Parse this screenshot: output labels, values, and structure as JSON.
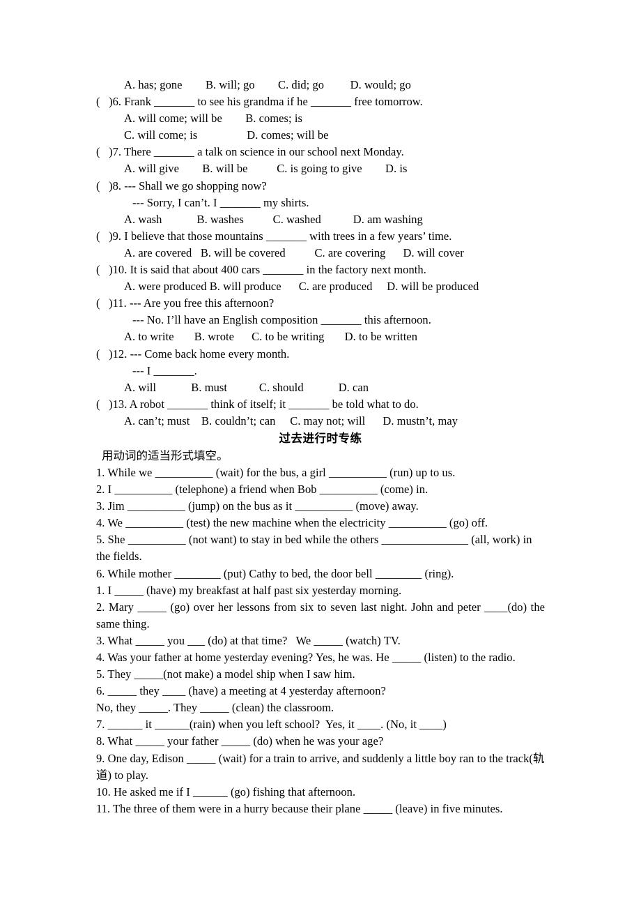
{
  "document": {
    "sections": [
      {
        "id": "multiple-choice-continued",
        "lines": [
          {
            "kind": "options",
            "text": "A. has; gone        B. will; go        C. did; go         D. would; go"
          },
          {
            "kind": "stem",
            "text": "(   )6. Frank _______ to see his grandma if he _______ free tomorrow."
          },
          {
            "kind": "options",
            "text": "A. will come; will be        B. comes; is"
          },
          {
            "kind": "options",
            "text": "C. will come; is                 D. comes; will be"
          },
          {
            "kind": "stem",
            "text": "(   )7. There _______ a talk on science in our school next Monday."
          },
          {
            "kind": "options",
            "text": "A. will give        B. will be          C. is going to give        D. is"
          },
          {
            "kind": "stem",
            "text": "(   )8. --- Shall we go shopping now?"
          },
          {
            "kind": "dash",
            "text": "--- Sorry, I can’t. I _______ my shirts."
          },
          {
            "kind": "options",
            "text": "A. wash            B. washes          C. washed           D. am washing"
          },
          {
            "kind": "stem",
            "text": "(   )9. I believe that those mountains _______ with trees in a few years’ time."
          },
          {
            "kind": "options",
            "text": "A. are covered   B. will be covered          C. are covering      D. will cover"
          },
          {
            "kind": "stem",
            "text": "(   )10. It is said that about 400 cars _______ in the factory next month."
          },
          {
            "kind": "options",
            "text": "A. were produced B. will produce      C. are produced     D. will be produced"
          },
          {
            "kind": "stem",
            "text": "(   )11. --- Are you free this afternoon?"
          },
          {
            "kind": "dash",
            "text": "--- No. I’ll have an English composition _______ this afternoon."
          },
          {
            "kind": "options",
            "text": "A. to write       B. wrote      C. to be writing       D. to be written"
          },
          {
            "kind": "stem",
            "text": "(   )12. --- Come back home every month."
          },
          {
            "kind": "dash",
            "text": "--- I _______."
          },
          {
            "kind": "options",
            "text": "A. will            B. must           C. should            D. can"
          },
          {
            "kind": "stem",
            "text": "(   )13. A robot _______ think of itself; it _______ be told what to do."
          },
          {
            "kind": "options",
            "text": "A. can’t; must    B. couldn’t; can     C. may not; will      D. mustn’t, may"
          }
        ]
      },
      {
        "id": "past-continuous-drill",
        "title": "过去进行时专练",
        "instruction": "用动词的适当形式填空。",
        "group_one": [
          {
            "num": "1.",
            "text": "1. While we __________ (wait) for the bus, a girl __________ (run) up to us."
          },
          {
            "num": "2.",
            "text": "2. I __________ (telephone) a friend when Bob __________ (come) in."
          },
          {
            "num": "3.",
            "text": "3. Jim __________ (jump) on the bus as it __________ (move) away."
          },
          {
            "num": "4.",
            "text": "4. We __________ (test) the new machine when the electricity __________ (go) off."
          },
          {
            "num": "5.",
            "text": "5. She __________ (not want) to stay in bed while the others _______________ (all, work) in the fields."
          },
          {
            "num": "6.",
            "text": "6. While mother ________ (put) Cathy to bed, the door bell ________ (ring)."
          }
        ],
        "group_two": [
          {
            "num": "1.",
            "text": "1. I _____ (have) my breakfast at half past six yesterday morning."
          },
          {
            "num": "2.",
            "text": "2. Mary _____ (go) over her lessons from six to seven last night. John and peter ____(do) the same thing."
          },
          {
            "num": "3.",
            "text": "3. What _____ you ___ (do) at that time?   We _____ (watch) TV."
          },
          {
            "num": "4.",
            "text": "4. Was your father at home yesterday evening? Yes, he was. He _____ (listen) to the radio."
          },
          {
            "num": "5.",
            "text": "5. They _____(not make) a model ship when I saw him."
          },
          {
            "num": "6.",
            "text": "6. _____ they ____ (have) a meeting at 4 yesterday afternoon?"
          },
          {
            "num": "6b.",
            "text": "No, they _____. They _____ (clean) the classroom."
          },
          {
            "num": "7.",
            "text": "7. ______ it ______(rain) when you left school?  Yes, it ____. (No, it ____)"
          },
          {
            "num": "8.",
            "text": "8. What _____ your father _____ (do) when he was your age?"
          },
          {
            "num": "9.",
            "text": "9. One day, Edison _____ (wait) for a train to arrive, and suddenly a little boy ran to the track(轨道) to play."
          },
          {
            "num": "10.",
            "text": "10. He asked me if I ______ (go) fishing that afternoon."
          },
          {
            "num": "11.",
            "text": "11. The three of them were in a hurry because their plane _____ (leave) in five minutes."
          }
        ]
      }
    ]
  },
  "style": {
    "text_color": "#000000",
    "background": "#ffffff"
  }
}
